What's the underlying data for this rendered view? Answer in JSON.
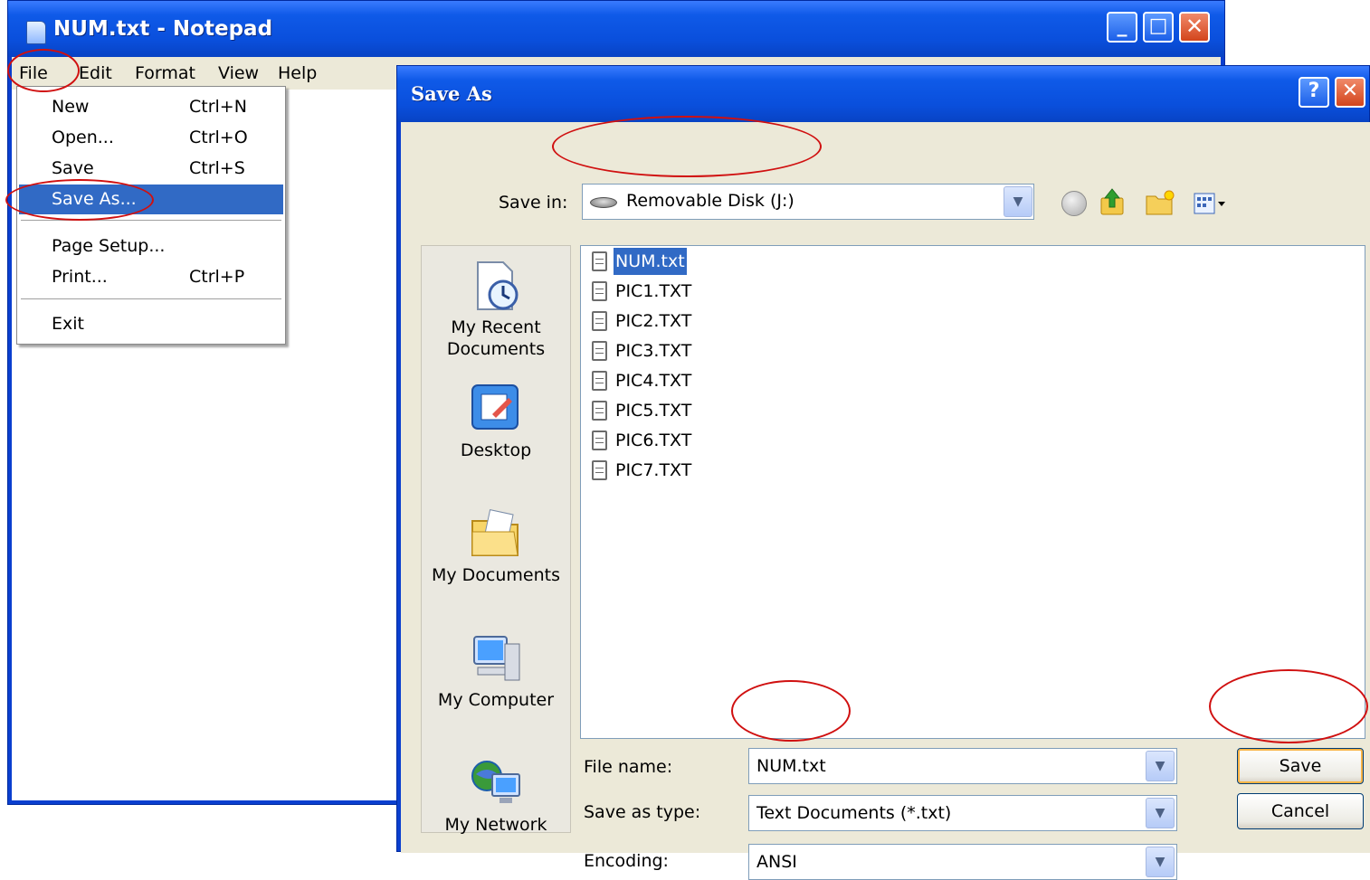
{
  "notepad": {
    "title": "NUM.txt - Notepad",
    "window_buttons": {
      "minimize": "_",
      "maximize": "□",
      "close": "✕"
    },
    "menu": [
      "File",
      "Edit",
      "Format",
      "View",
      "Help"
    ]
  },
  "file_menu": {
    "items": [
      {
        "label": "New",
        "shortcut": "Ctrl+N"
      },
      {
        "label": "Open...",
        "shortcut": "Ctrl+O"
      },
      {
        "label": "Save",
        "shortcut": "Ctrl+S"
      },
      {
        "label": "Save As...",
        "shortcut": "",
        "selected": true
      },
      {
        "label": "Page Setup...",
        "shortcut": ""
      },
      {
        "label": "Print...",
        "shortcut": "Ctrl+P"
      },
      {
        "label": "Exit",
        "shortcut": ""
      }
    ]
  },
  "dialog": {
    "title": "Save As",
    "window_buttons": {
      "help": "?",
      "close": "✕"
    },
    "save_in_label": "Save in:",
    "save_in_value": "Removable Disk (J:)",
    "places": [
      "My Recent Documents",
      "Desktop",
      "My Documents",
      "My Computer",
      "My Network"
    ],
    "files": [
      "NUM.txt",
      "PIC1.TXT",
      "PIC2.TXT",
      "PIC3.TXT",
      "PIC4.TXT",
      "PIC5.TXT",
      "PIC6.TXT",
      "PIC7.TXT"
    ],
    "selected_file": "NUM.txt",
    "file_name_label": "File name:",
    "file_name_value": "NUM.txt",
    "save_as_type_label": "Save as type:",
    "save_as_type_value": "Text Documents (*.txt)",
    "encoding_label": "Encoding:",
    "encoding_value": "ANSI",
    "save_button": "Save",
    "cancel_button": "Cancel"
  },
  "colors": {
    "annotation": "#d01010",
    "selection": "#316ac5",
    "titlebar": "#0a4fdc"
  }
}
